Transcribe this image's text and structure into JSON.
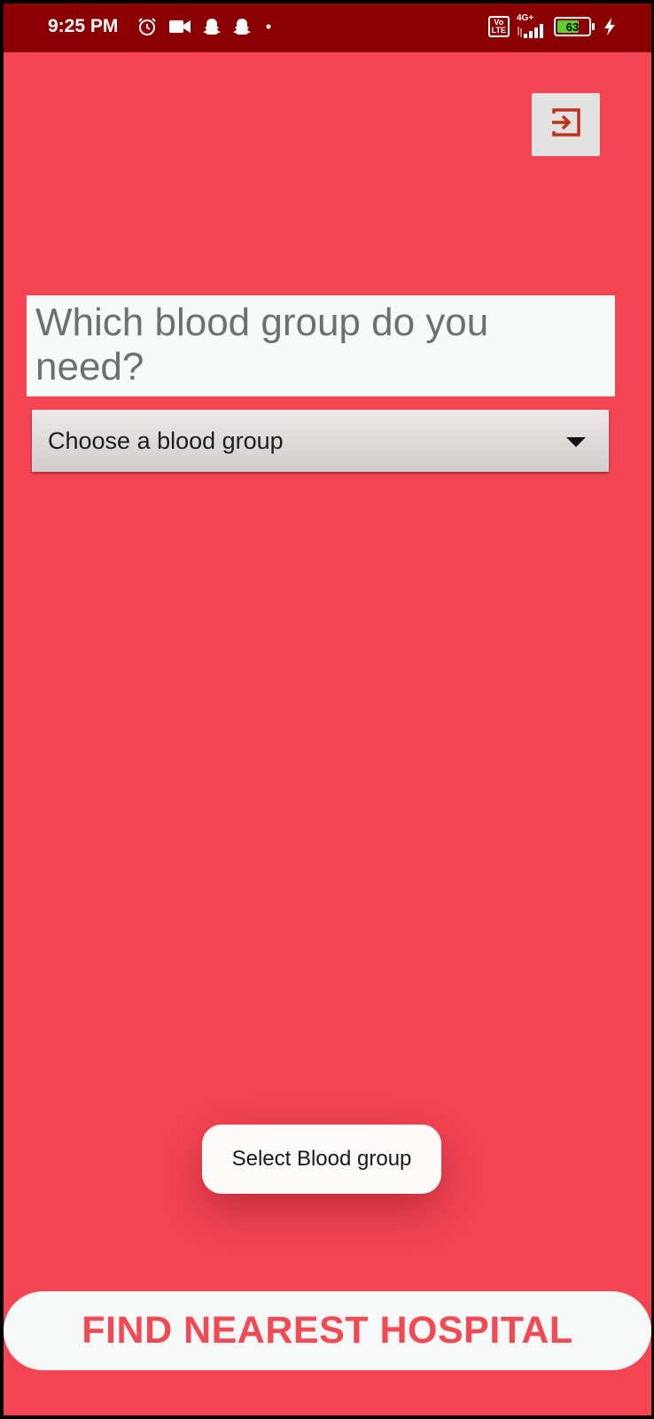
{
  "status_bar": {
    "time": "9:25 PM",
    "left_icons": [
      "alarm-icon",
      "video-camera-icon",
      "snapchat-icon",
      "snapchat-icon",
      "dot-icon"
    ],
    "volte_label": "Vo\nLTE",
    "network_label": "4G+",
    "battery_level": "63",
    "charging": true,
    "colors": {
      "background": "#8b0000",
      "battery_fill": "#5ed02b"
    }
  },
  "header": {
    "exit_icon": "exit-icon",
    "exit_icon_color": "#c0311d"
  },
  "main": {
    "question": "Which blood group do you need?",
    "blood_group_select": {
      "selected_value": "Choose a blood group",
      "icon": "chevron-down-icon"
    }
  },
  "toast": {
    "message": "Select Blood group"
  },
  "footer": {
    "find_button_label": "FIND NEAREST HOSPITAL"
  },
  "theme": {
    "background": "#f54452",
    "button_text": "#f04a55"
  }
}
